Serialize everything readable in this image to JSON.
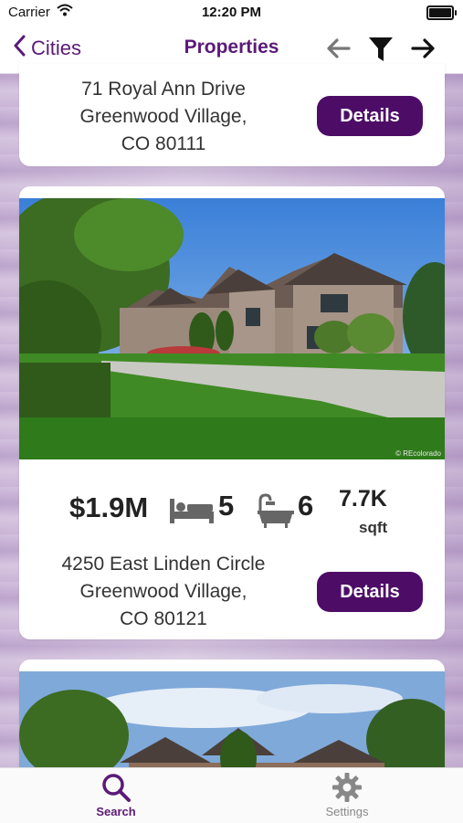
{
  "status_bar": {
    "carrier": "Carrier",
    "time": "12:20 PM"
  },
  "nav": {
    "back_label": "Cities",
    "title": "Properties"
  },
  "listings": [
    {
      "address_line1": "71 Royal Ann Drive",
      "address_line2": "Greenwood Village,",
      "address_line3": "CO 80111",
      "details_label": "Details"
    },
    {
      "price": "$1.9M",
      "beds": "5",
      "baths": "6",
      "sqft": "7.7K",
      "sqft_unit": "sqft",
      "photo_credit": "© REcolorado",
      "address_line1": "4250 East Linden Circle",
      "address_line2": "Greenwood Village,",
      "address_line3": "CO 80121",
      "details_label": "Details"
    }
  ],
  "tabbar": {
    "search_label": "Search",
    "settings_label": "Settings"
  },
  "colors": {
    "accent": "#4d0d66",
    "tab_active": "#5b1a78",
    "background": "#cbb9d6"
  },
  "icons": [
    "wifi-icon",
    "battery-icon",
    "chevron-left-icon",
    "arrow-left-icon",
    "filter-icon",
    "arrow-right-icon",
    "bed-icon",
    "bathtub-icon",
    "search-icon",
    "gear-icon"
  ]
}
